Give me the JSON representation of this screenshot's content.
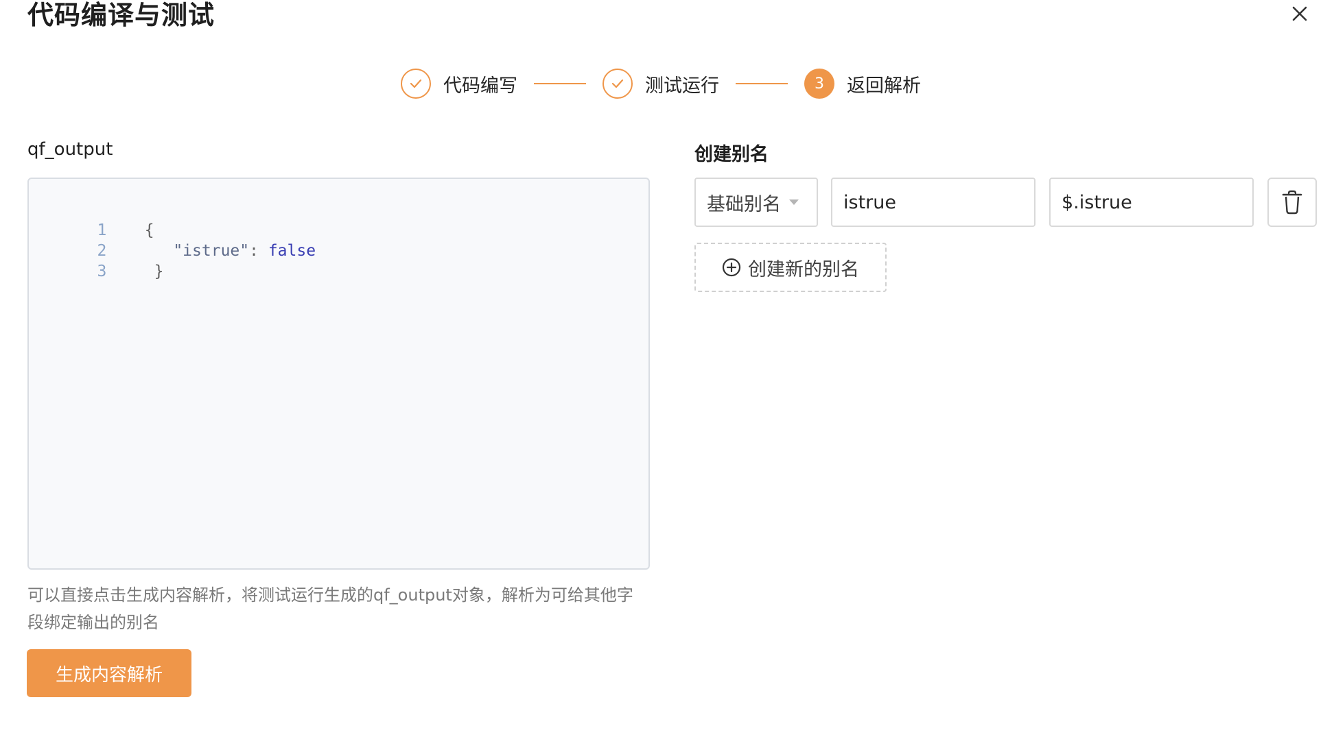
{
  "dialog": {
    "title": "代码编译与测试"
  },
  "steps": [
    {
      "label": "代码编写",
      "status": "done"
    },
    {
      "label": "测试运行",
      "status": "done"
    },
    {
      "number": "3",
      "label": "返回解析",
      "status": "active"
    }
  ],
  "output": {
    "label": "qf_output",
    "code_lines": [
      {
        "num": "1",
        "text": "{"
      },
      {
        "num": "2",
        "key": "\"istrue\"",
        "sep": ": ",
        "value": "false"
      },
      {
        "num": "3",
        "text": "}"
      }
    ],
    "hint": "可以直接点击生成内容解析，将测试运行生成的qf_output对象，解析为可给其他字段绑定输出的别名",
    "generate_button": "生成内容解析"
  },
  "alias": {
    "title": "创建别名",
    "rows": [
      {
        "type": "基础别名",
        "name": "istrue",
        "path": "$.istrue"
      }
    ],
    "add_button": "创建新的别名"
  },
  "colors": {
    "accent": "#ef9649",
    "border": "#d9d9d9",
    "editor_bg": "#f8f9fb"
  },
  "icons": {
    "close": "close-icon",
    "check": "check-icon",
    "delete": "trash-icon",
    "add": "plus-circle-icon",
    "caret": "caret-down-icon"
  }
}
